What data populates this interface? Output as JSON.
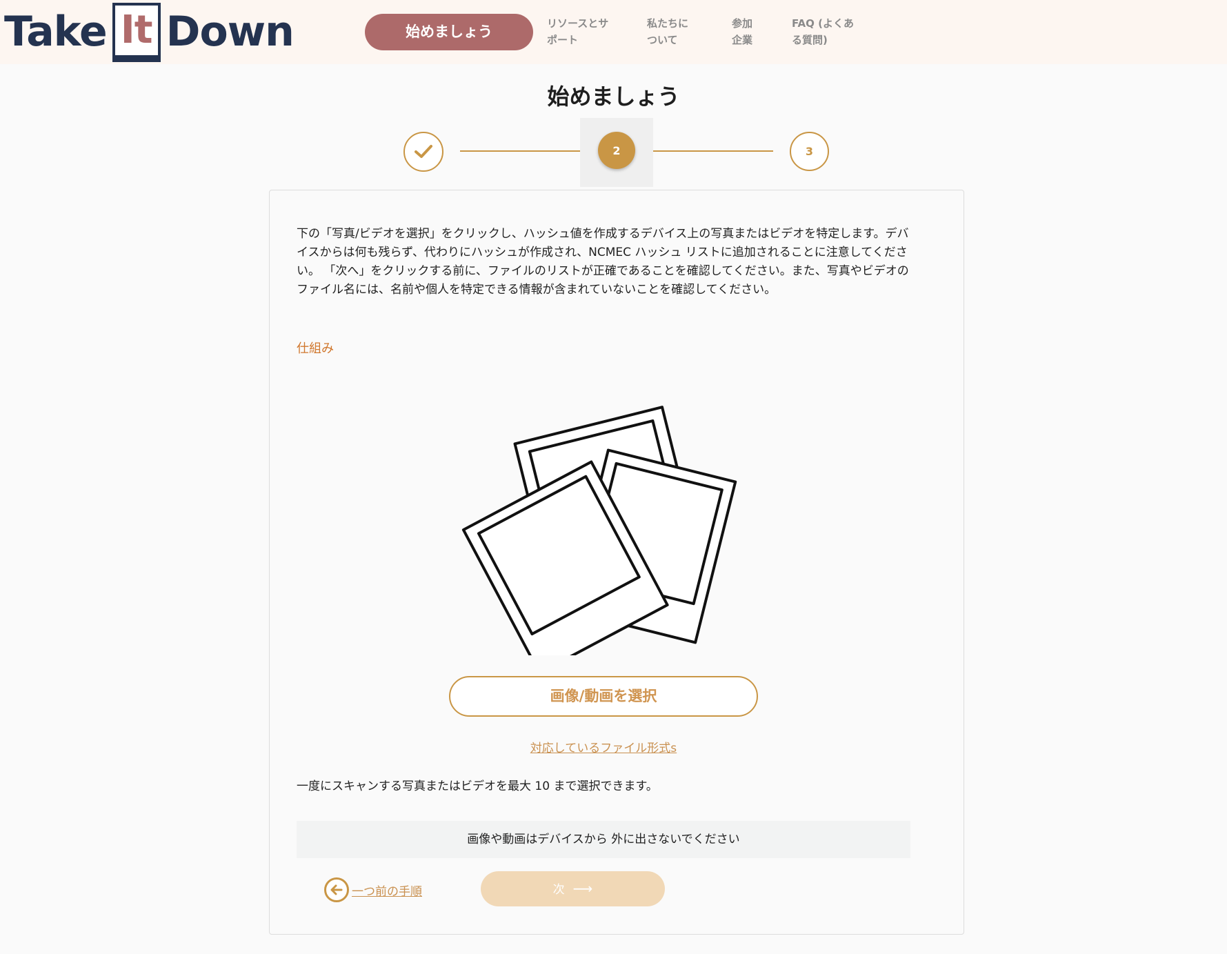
{
  "header": {
    "logo": {
      "word1": "Take",
      "word2": "It",
      "word3": "Down"
    },
    "cta_label": "始めましょう",
    "nav": [
      {
        "line1": "リソースとサ",
        "line2": "ポート"
      },
      {
        "line1": "私たちに",
        "line2": "ついて"
      },
      {
        "line1": "参加",
        "line2": "企業"
      },
      {
        "line1": "FAQ (よくあ",
        "line2": "る質問)"
      }
    ]
  },
  "page_title": "始めましょう",
  "stepper": {
    "steps": [
      {
        "state": "done",
        "icon": "checkmark-icon"
      },
      {
        "state": "current",
        "label": "2"
      },
      {
        "state": "upcoming",
        "label": "3"
      }
    ],
    "accent_color": "#c99645"
  },
  "main": {
    "intro": "下の「写真/ビデオを選択」をクリックし、ハッシュ値を作成するデバイス上の写真またはビデオを特定します。デバイスからは何も残らず、代わりにハッシュが作成され、NCMEC ハッシュ リストに追加されることに注意してください。 「次へ」をクリックする前に、ファイルのリストが正確であることを確認してください。また、写真やビデオのファイル名には、名前や個人を特定できる情報が含まれていないことを確認してください。",
    "how_it_works_link": "仕組み",
    "illustration_icon": "photos-illustration",
    "select_button": "画像/動画を選択",
    "formats_link": "対応しているファイル形式s",
    "limit_text": "一度にスキャンする写真またはビデオを最大 10 まで選択できます。",
    "notice": "画像や動画はデバイスから 外に出さないでください",
    "back_label": "一つ前の手順",
    "next_label": "次",
    "next_arrow": "⟶"
  },
  "colors": {
    "brand_navy": "#243350",
    "brand_rose": "#ad6a6a",
    "accent_gold": "#c99645",
    "link_orange": "#d0772d",
    "disabled_next": "#f1d8b6"
  }
}
